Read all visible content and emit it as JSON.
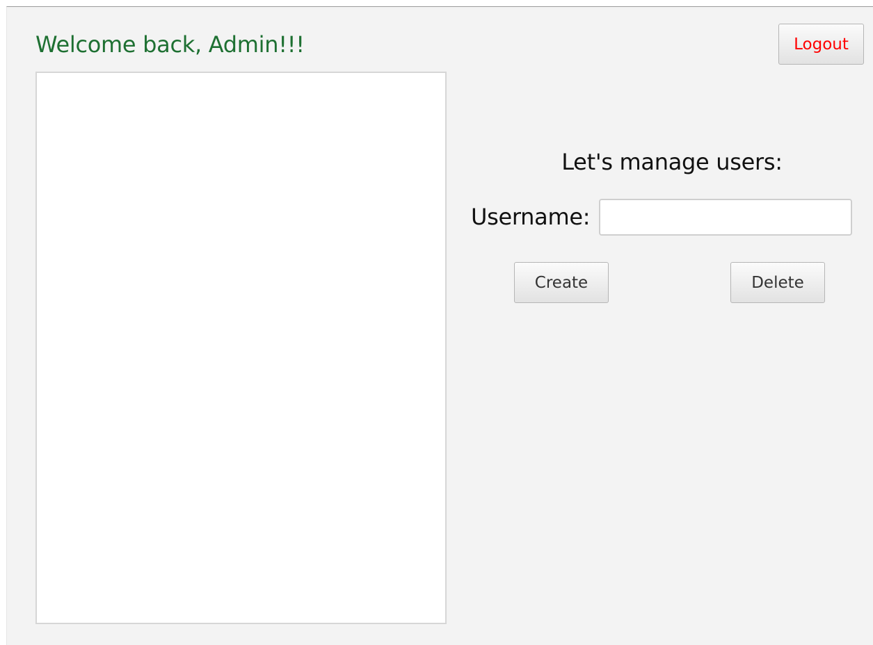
{
  "header": {
    "welcome_text": "Welcome back, Admin!!!",
    "logout_label": "Logout"
  },
  "manage": {
    "title": "Let's manage users:",
    "username_label": "Username:",
    "username_value": "",
    "username_placeholder": "",
    "create_label": "Create",
    "delete_label": "Delete"
  },
  "user_list": {
    "items": []
  },
  "colors": {
    "welcome_text": "#1e7032",
    "logout_text": "#ff0000",
    "background": "#f3f3f3"
  }
}
